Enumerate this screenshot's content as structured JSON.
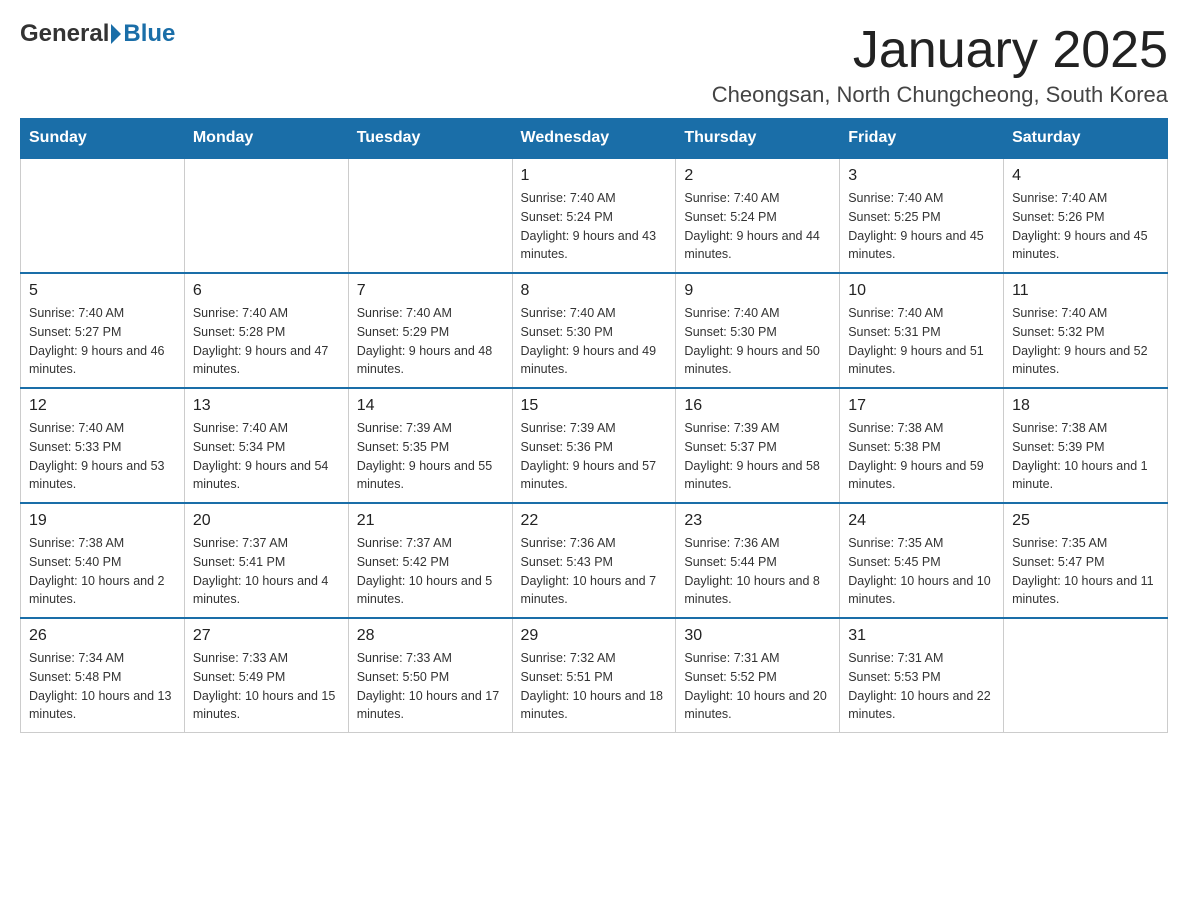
{
  "logo": {
    "general": "General",
    "blue": "Blue"
  },
  "title": "January 2025",
  "subtitle": "Cheongsan, North Chungcheong, South Korea",
  "days_of_week": [
    "Sunday",
    "Monday",
    "Tuesday",
    "Wednesday",
    "Thursday",
    "Friday",
    "Saturday"
  ],
  "weeks": [
    [
      {
        "day": "",
        "info": ""
      },
      {
        "day": "",
        "info": ""
      },
      {
        "day": "",
        "info": ""
      },
      {
        "day": "1",
        "info": "Sunrise: 7:40 AM\nSunset: 5:24 PM\nDaylight: 9 hours and 43 minutes."
      },
      {
        "day": "2",
        "info": "Sunrise: 7:40 AM\nSunset: 5:24 PM\nDaylight: 9 hours and 44 minutes."
      },
      {
        "day": "3",
        "info": "Sunrise: 7:40 AM\nSunset: 5:25 PM\nDaylight: 9 hours and 45 minutes."
      },
      {
        "day": "4",
        "info": "Sunrise: 7:40 AM\nSunset: 5:26 PM\nDaylight: 9 hours and 45 minutes."
      }
    ],
    [
      {
        "day": "5",
        "info": "Sunrise: 7:40 AM\nSunset: 5:27 PM\nDaylight: 9 hours and 46 minutes."
      },
      {
        "day": "6",
        "info": "Sunrise: 7:40 AM\nSunset: 5:28 PM\nDaylight: 9 hours and 47 minutes."
      },
      {
        "day": "7",
        "info": "Sunrise: 7:40 AM\nSunset: 5:29 PM\nDaylight: 9 hours and 48 minutes."
      },
      {
        "day": "8",
        "info": "Sunrise: 7:40 AM\nSunset: 5:30 PM\nDaylight: 9 hours and 49 minutes."
      },
      {
        "day": "9",
        "info": "Sunrise: 7:40 AM\nSunset: 5:30 PM\nDaylight: 9 hours and 50 minutes."
      },
      {
        "day": "10",
        "info": "Sunrise: 7:40 AM\nSunset: 5:31 PM\nDaylight: 9 hours and 51 minutes."
      },
      {
        "day": "11",
        "info": "Sunrise: 7:40 AM\nSunset: 5:32 PM\nDaylight: 9 hours and 52 minutes."
      }
    ],
    [
      {
        "day": "12",
        "info": "Sunrise: 7:40 AM\nSunset: 5:33 PM\nDaylight: 9 hours and 53 minutes."
      },
      {
        "day": "13",
        "info": "Sunrise: 7:40 AM\nSunset: 5:34 PM\nDaylight: 9 hours and 54 minutes."
      },
      {
        "day": "14",
        "info": "Sunrise: 7:39 AM\nSunset: 5:35 PM\nDaylight: 9 hours and 55 minutes."
      },
      {
        "day": "15",
        "info": "Sunrise: 7:39 AM\nSunset: 5:36 PM\nDaylight: 9 hours and 57 minutes."
      },
      {
        "day": "16",
        "info": "Sunrise: 7:39 AM\nSunset: 5:37 PM\nDaylight: 9 hours and 58 minutes."
      },
      {
        "day": "17",
        "info": "Sunrise: 7:38 AM\nSunset: 5:38 PM\nDaylight: 9 hours and 59 minutes."
      },
      {
        "day": "18",
        "info": "Sunrise: 7:38 AM\nSunset: 5:39 PM\nDaylight: 10 hours and 1 minute."
      }
    ],
    [
      {
        "day": "19",
        "info": "Sunrise: 7:38 AM\nSunset: 5:40 PM\nDaylight: 10 hours and 2 minutes."
      },
      {
        "day": "20",
        "info": "Sunrise: 7:37 AM\nSunset: 5:41 PM\nDaylight: 10 hours and 4 minutes."
      },
      {
        "day": "21",
        "info": "Sunrise: 7:37 AM\nSunset: 5:42 PM\nDaylight: 10 hours and 5 minutes."
      },
      {
        "day": "22",
        "info": "Sunrise: 7:36 AM\nSunset: 5:43 PM\nDaylight: 10 hours and 7 minutes."
      },
      {
        "day": "23",
        "info": "Sunrise: 7:36 AM\nSunset: 5:44 PM\nDaylight: 10 hours and 8 minutes."
      },
      {
        "day": "24",
        "info": "Sunrise: 7:35 AM\nSunset: 5:45 PM\nDaylight: 10 hours and 10 minutes."
      },
      {
        "day": "25",
        "info": "Sunrise: 7:35 AM\nSunset: 5:47 PM\nDaylight: 10 hours and 11 minutes."
      }
    ],
    [
      {
        "day": "26",
        "info": "Sunrise: 7:34 AM\nSunset: 5:48 PM\nDaylight: 10 hours and 13 minutes."
      },
      {
        "day": "27",
        "info": "Sunrise: 7:33 AM\nSunset: 5:49 PM\nDaylight: 10 hours and 15 minutes."
      },
      {
        "day": "28",
        "info": "Sunrise: 7:33 AM\nSunset: 5:50 PM\nDaylight: 10 hours and 17 minutes."
      },
      {
        "day": "29",
        "info": "Sunrise: 7:32 AM\nSunset: 5:51 PM\nDaylight: 10 hours and 18 minutes."
      },
      {
        "day": "30",
        "info": "Sunrise: 7:31 AM\nSunset: 5:52 PM\nDaylight: 10 hours and 20 minutes."
      },
      {
        "day": "31",
        "info": "Sunrise: 7:31 AM\nSunset: 5:53 PM\nDaylight: 10 hours and 22 minutes."
      },
      {
        "day": "",
        "info": ""
      }
    ]
  ]
}
